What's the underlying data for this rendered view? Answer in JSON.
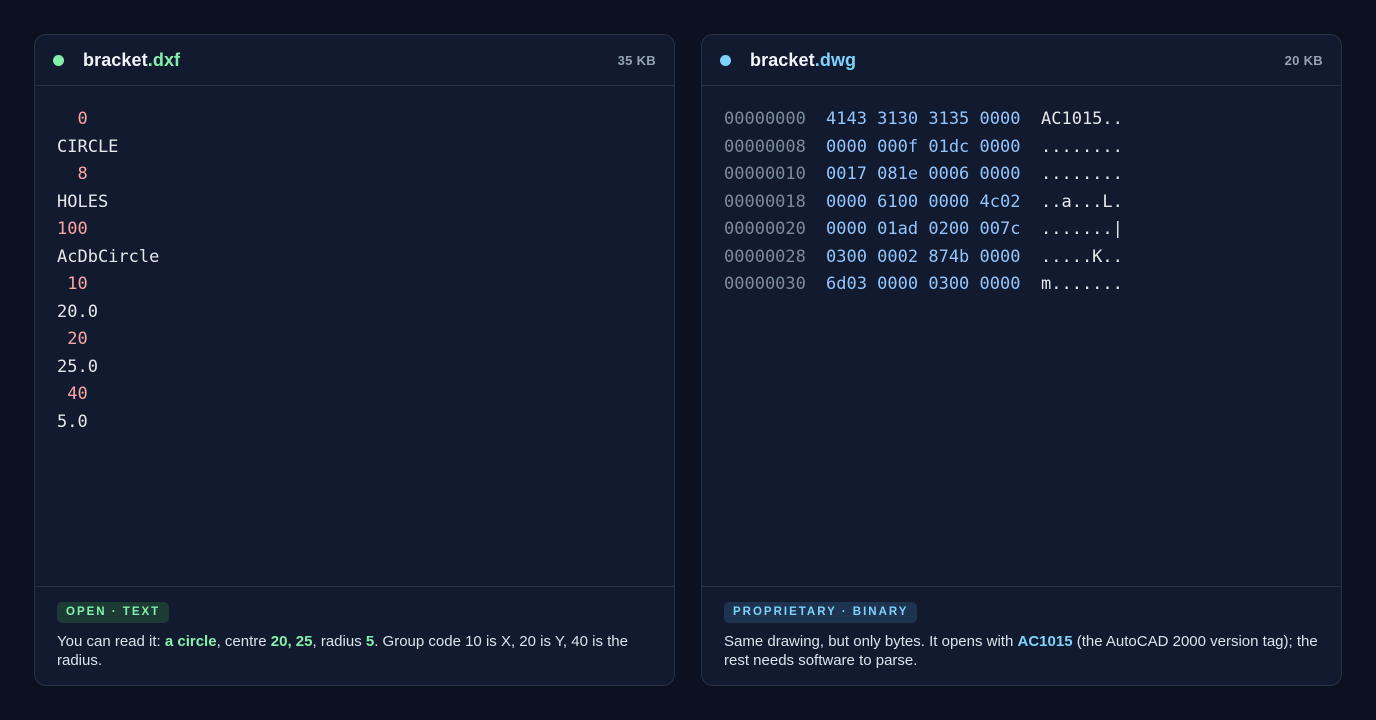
{
  "left_panel": {
    "filename_base": "bracket",
    "filename_ext": ".dxf",
    "size": "35 KB",
    "lines": [
      {
        "kind": "code",
        "text": "  0"
      },
      {
        "kind": "value",
        "text": "CIRCLE"
      },
      {
        "kind": "code",
        "text": "  8"
      },
      {
        "kind": "value",
        "text": "HOLES"
      },
      {
        "kind": "code",
        "text": "100"
      },
      {
        "kind": "value",
        "text": "AcDbCircle"
      },
      {
        "kind": "code",
        "text": " 10"
      },
      {
        "kind": "value",
        "text": "20.0"
      },
      {
        "kind": "code",
        "text": " 20"
      },
      {
        "kind": "value",
        "text": "25.0"
      },
      {
        "kind": "code",
        "text": " 40"
      },
      {
        "kind": "value",
        "text": "5.0"
      }
    ],
    "badge": "OPEN · TEXT",
    "desc": {
      "p1": "You can read it: ",
      "h1": "a circle",
      "p2": ", centre ",
      "h2": "20, 25",
      "p3": ", radius ",
      "h3": "5",
      "p4": ". Group code 10 is X, 20 is Y, 40 is the radius."
    }
  },
  "right_panel": {
    "filename_base": "bracket",
    "filename_ext": ".dwg",
    "size": "20 KB",
    "rows": [
      {
        "offset": "00000000",
        "bytes": "4143 3130 3135 0000",
        "ascii": "AC1015.."
      },
      {
        "offset": "00000008",
        "bytes": "0000 000f 01dc 0000",
        "ascii": "........"
      },
      {
        "offset": "00000010",
        "bytes": "0017 081e 0006 0000",
        "ascii": "........"
      },
      {
        "offset": "00000018",
        "bytes": "0000 6100 0000 4c02",
        "ascii": "..a...L."
      },
      {
        "offset": "00000020",
        "bytes": "0000 01ad 0200 007c",
        "ascii": ".......|"
      },
      {
        "offset": "00000028",
        "bytes": "0300 0002 874b 0000",
        "ascii": ".....K.."
      },
      {
        "offset": "00000030",
        "bytes": "6d03 0000 0300 0000",
        "ascii": "m......."
      }
    ],
    "badge": "PROPRIETARY · BINARY",
    "desc": {
      "p1": "Same drawing, but only bytes. It opens with ",
      "h1": "AC1015",
      "p2": " (the AutoCAD 2000 version tag); the rest needs software to parse."
    }
  },
  "colors": {
    "background": "#0b1120",
    "panel": "#111a2e",
    "accent_green": "#86efac",
    "accent_blue": "#7dd3fc",
    "group_code": "#fca5a5",
    "hex_bytes": "#93c5fd"
  }
}
